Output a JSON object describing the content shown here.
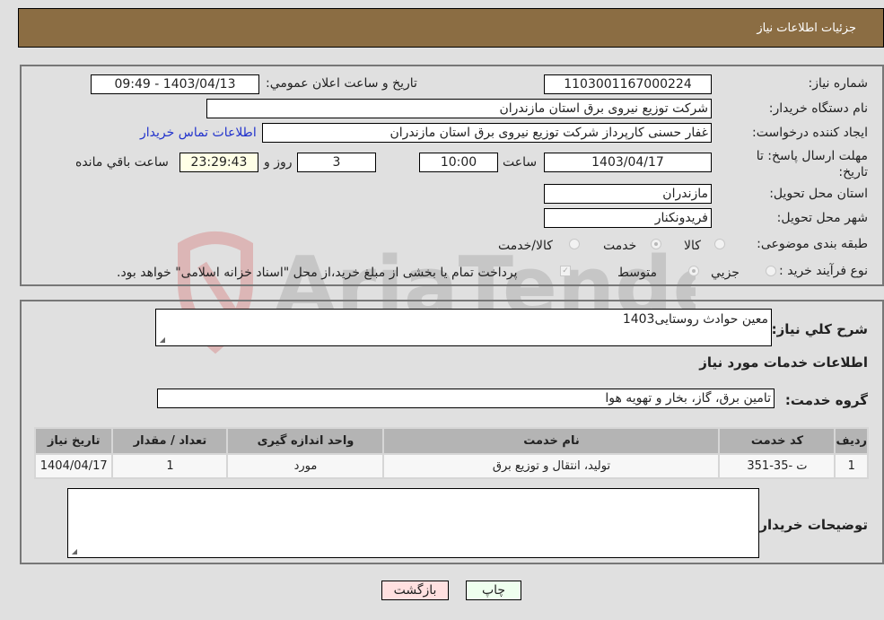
{
  "header": {
    "title": "جزئیات اطلاعات نیاز"
  },
  "form": {
    "need_number": {
      "label": "شماره نیاز:",
      "value": "1103001167000224"
    },
    "announce_datetime": {
      "label": "تاریخ و ساعت اعلان عمومي:",
      "value": "1403/04/13 - 09:49"
    },
    "buyer_org": {
      "label": "نام دستگاه خریدار:",
      "value": "شرکت توزیع نیروی برق استان مازندران"
    },
    "requester": {
      "label": "ایجاد کننده درخواست:",
      "value": "غفار حسنی کارپرداز شرکت توزیع نیروی برق استان مازندران"
    },
    "buyer_contact_link": "اطلاعات تماس خریدار",
    "deadline": {
      "label": "مهلت ارسال پاسخ: تا تاریخ:",
      "date": "1403/04/17",
      "time_label": "ساعت",
      "time": "10:00",
      "days": "3",
      "days_label": "روز و",
      "remaining": "23:29:43",
      "remaining_label": "ساعت باقي مانده"
    },
    "province": {
      "label": "استان محل تحویل:",
      "value": "مازندران"
    },
    "city": {
      "label": "شهر محل تحویل:",
      "value": "فریدونکنار"
    },
    "category": {
      "label": "طبقه بندی موضوعی:",
      "options": [
        "کالا",
        "خدمت",
        "کالا/خدمت"
      ],
      "selected": "خدمت"
    },
    "purchase_process": {
      "label": "نوع فرآیند خرید :",
      "options": [
        "جزيي",
        "متوسط"
      ],
      "selected": "متوسط",
      "treasury_checkbox_label": "پرداخت تمام یا بخشی از مبلغ خرید،از محل \"اسناد خزانه اسلامی\" خواهد بود.",
      "treasury_checked": true
    }
  },
  "details": {
    "description": {
      "label": "شرح کلي نياز:",
      "value": "معین حوادث روستایی1403"
    },
    "services_heading": "اطلاعات خدمات مورد نياز",
    "service_group": {
      "label": "گروه خدمت:",
      "value": "تامین برق، گاز، بخار و تهویه هوا"
    },
    "table": {
      "headers": [
        "رديف",
        "کد خدمت",
        "نام خدمت",
        "واحد اندازه گیری",
        "تعداد / مقدار",
        "تاریخ نیاز"
      ],
      "rows": [
        [
          "1",
          "ت -35-351",
          "تولید، انتقال و توزیع برق",
          "مورد",
          "1",
          "1404/04/17"
        ]
      ]
    },
    "buyer_notes": {
      "label": "توضیحات خریدار:",
      "value": ""
    }
  },
  "buttons": {
    "print": "چاپ",
    "back": "بازگشت"
  },
  "colors": {
    "header_bg": "#8b6d43",
    "print_bg": "#eeffee",
    "back_bg": "#ffe0e0",
    "link": "#2233cc"
  }
}
